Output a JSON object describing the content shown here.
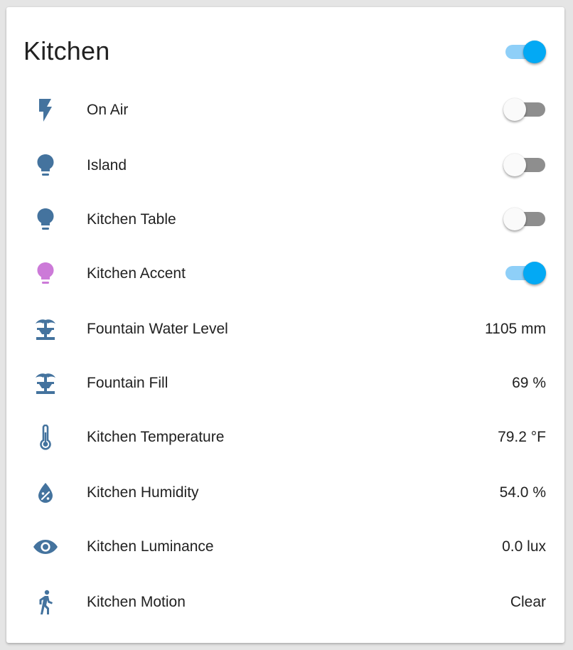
{
  "card": {
    "title": "Kitchen",
    "master_toggle_on": true
  },
  "colors": {
    "icon_default": "#44739e",
    "icon_accent_light": "#cc7ad8",
    "toggle_on": "#03a9f4",
    "toggle_on_track": "#8ecff8",
    "toggle_off_track": "#8e8e8e",
    "toggle_off_thumb": "#fafafa"
  },
  "entities": [
    {
      "icon": "flash-icon",
      "label": "On Air",
      "type": "toggle",
      "on": false
    },
    {
      "icon": "lightbulb-icon",
      "label": "Island",
      "type": "toggle",
      "on": false
    },
    {
      "icon": "lightbulb-icon",
      "label": "Kitchen Table",
      "type": "toggle",
      "on": false
    },
    {
      "icon": "lightbulb-icon",
      "label": "Kitchen Accent",
      "type": "toggle",
      "on": true
    },
    {
      "icon": "fountain-icon",
      "label": "Fountain Water Level",
      "type": "sensor",
      "value": "1105 mm"
    },
    {
      "icon": "fountain-icon",
      "label": "Fountain Fill",
      "type": "sensor",
      "value": "69 %"
    },
    {
      "icon": "thermometer-icon",
      "label": "Kitchen Temperature",
      "type": "sensor",
      "value": "79.2 °F"
    },
    {
      "icon": "water-percent-icon",
      "label": "Kitchen Humidity",
      "type": "sensor",
      "value": "54.0 %"
    },
    {
      "icon": "eye-icon",
      "label": "Kitchen Luminance",
      "type": "sensor",
      "value": "0.0 lux"
    },
    {
      "icon": "walk-icon",
      "label": "Kitchen Motion",
      "type": "sensor",
      "value": "Clear"
    }
  ]
}
